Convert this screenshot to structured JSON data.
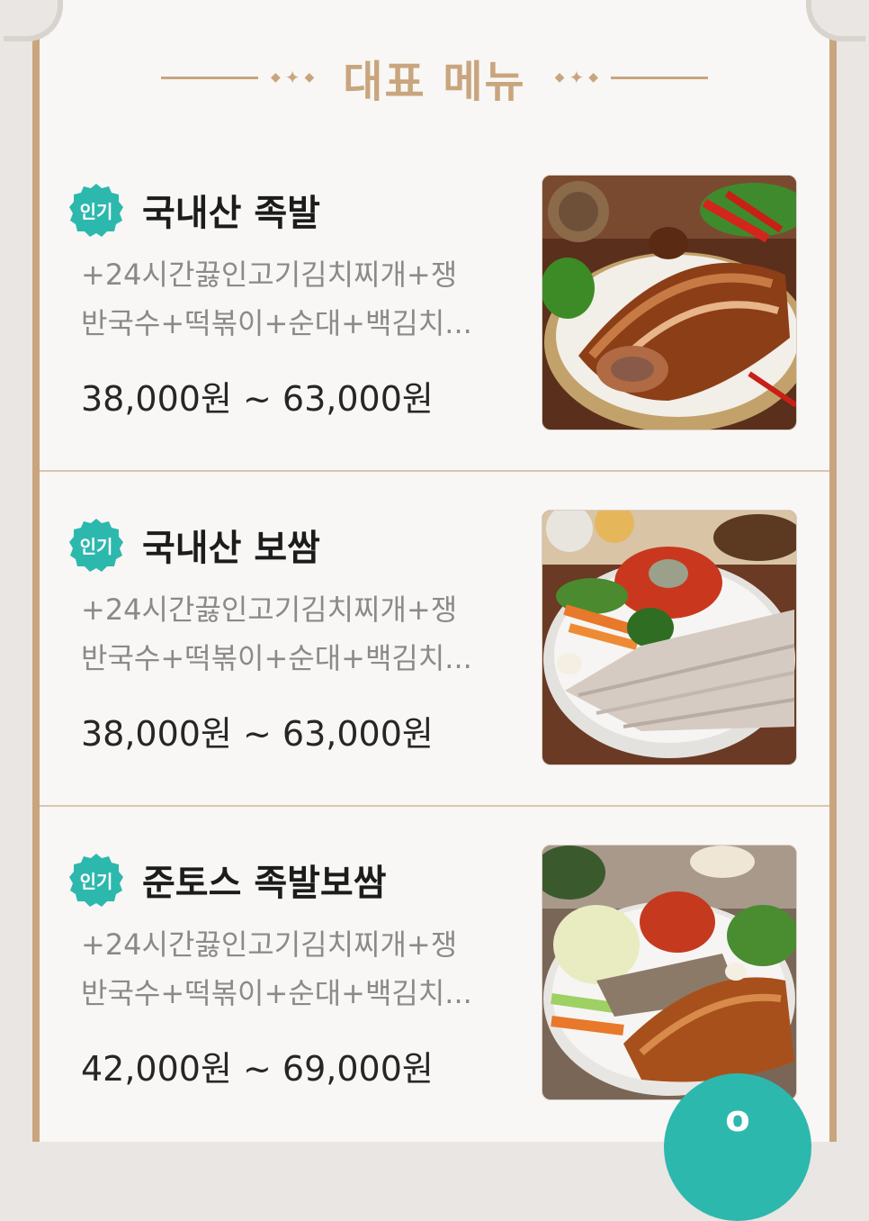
{
  "section": {
    "title": "대표 메뉴"
  },
  "badge_color": "#2db8ae",
  "accent_color": "#c9a57e",
  "menu": [
    {
      "badge": "인기",
      "name": "국내산 족발",
      "desc_line1": "+24시간끓인고기김치찌개+쟁",
      "desc_line2": "반국수+떡볶이+순대+백김치...",
      "price": "38,000원 ~ 63,000원",
      "image": "jokbal-photo"
    },
    {
      "badge": "인기",
      "name": "국내산 보쌈",
      "desc_line1": "+24시간끓인고기김치찌개+쟁",
      "desc_line2": "반국수+떡볶이+순대+백김치...",
      "price": "38,000원 ~ 63,000원",
      "image": "bossam-photo"
    },
    {
      "badge": "인기",
      "name": "준토스 족발보쌈",
      "desc_line1": "+24시간끓인고기김치찌개+쟁",
      "desc_line2": "반국수+떡볶이+순대+백김치...",
      "price": "42,000원 ~ 69,000원",
      "image": "jokbal-bossam-photo"
    }
  ],
  "fab": {
    "label": "o",
    "icon": "floating-action-icon"
  }
}
